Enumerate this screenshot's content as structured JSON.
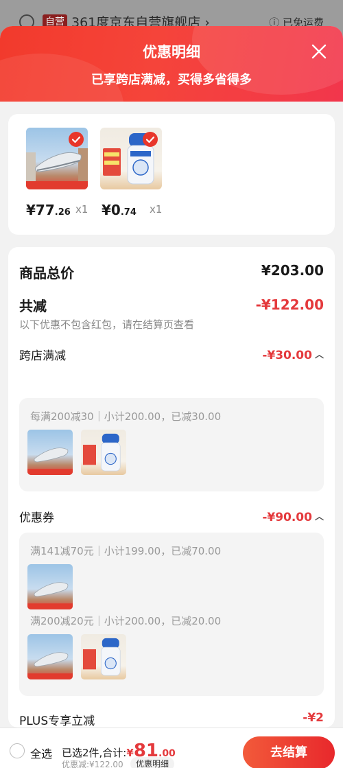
{
  "background_store": {
    "tag": "自营",
    "name": "361度京东自营旗舰店 ›",
    "shipping": "ⓘ 已免运费"
  },
  "header": {
    "title": "优惠明细",
    "subtitle": "已享跨店满减，买得多省得多"
  },
  "products": [
    {
      "price_int": "¥77",
      "price_dec": ".26",
      "qty": "x1"
    },
    {
      "price_int": "¥0",
      "price_dec": ".74",
      "qty": "x1"
    }
  ],
  "summary": {
    "goods_total_label": "商品总价",
    "goods_total_value": "¥203.00",
    "total_discount_label": "共减",
    "total_discount_value": "-¥122.00",
    "note": "以下优惠不包含红包，请在结算页查看"
  },
  "cross_store": {
    "label": "跨店满减",
    "value": "-¥30.00",
    "rule": "每满200减30｜小计200.00，已减30.00"
  },
  "coupons": {
    "label": "优惠券",
    "value": "-¥90.00",
    "rules": [
      "满141减70元｜小计199.00，已减70.00",
      "满200减20元｜小计200.00，已减20.00"
    ]
  },
  "plus": {
    "label": "PLUS专享立减",
    "value": "-¥2"
  },
  "bottom_bar": {
    "select_all": "全选",
    "selected_info": "已选2件,合计:",
    "total_symbol": "¥",
    "total_int": "81",
    "total_dec": ".00",
    "discount_line": "优惠减:¥122.00",
    "detail_label": "优惠明细",
    "checkout_label": "去结算"
  },
  "colors": {
    "accent_red": "#e4393c",
    "header_red": "#f23a2c"
  }
}
